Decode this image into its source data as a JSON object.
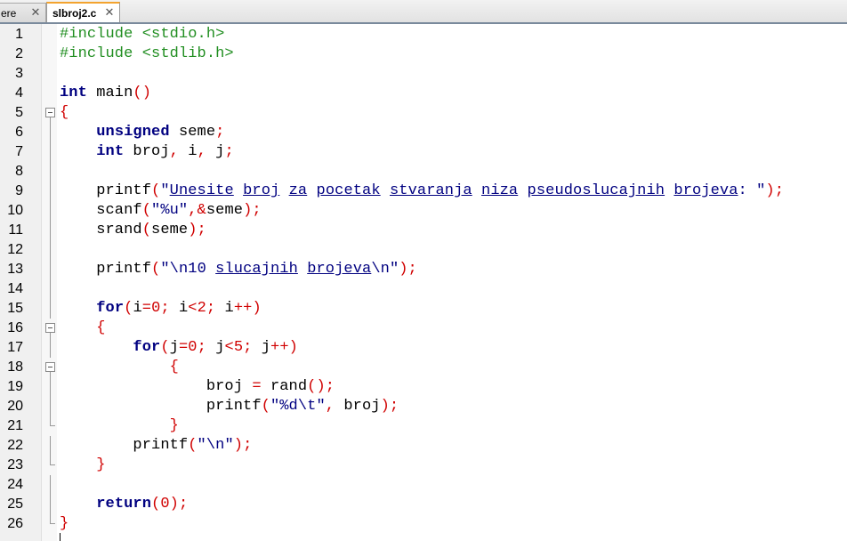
{
  "tabs": [
    {
      "label": "ere",
      "active": false
    },
    {
      "label": "slbroj2.c",
      "active": true
    }
  ],
  "colors": {
    "preprocessor": "#218e21",
    "keyword": "#000080",
    "operator": "#d00000",
    "string": "#000080",
    "tab_accent": "#f3a32e"
  },
  "code_lines": [
    {
      "n": "1",
      "fold": "",
      "tokens": [
        [
          "pre",
          "#include <stdio.h>"
        ]
      ]
    },
    {
      "n": "2",
      "fold": "",
      "tokens": [
        [
          "pre",
          "#include <stdlib.h>"
        ]
      ]
    },
    {
      "n": "3",
      "fold": "",
      "tokens": []
    },
    {
      "n": "4",
      "fold": "",
      "tokens": [
        [
          "kw",
          "int"
        ],
        [
          "plain",
          " main"
        ],
        [
          "op",
          "()"
        ]
      ]
    },
    {
      "n": "5",
      "fold": "open",
      "tokens": [
        [
          "op",
          "{"
        ]
      ]
    },
    {
      "n": "6",
      "fold": "line",
      "tokens": [
        [
          "plain",
          "    "
        ],
        [
          "kw",
          "unsigned"
        ],
        [
          "plain",
          " seme"
        ],
        [
          "op",
          ";"
        ]
      ]
    },
    {
      "n": "7",
      "fold": "line",
      "tokens": [
        [
          "plain",
          "    "
        ],
        [
          "kw",
          "int"
        ],
        [
          "plain",
          " broj"
        ],
        [
          "op",
          ","
        ],
        [
          "plain",
          " i"
        ],
        [
          "op",
          ","
        ],
        [
          "plain",
          " j"
        ],
        [
          "op",
          ";"
        ]
      ]
    },
    {
      "n": "8",
      "fold": "line",
      "tokens": []
    },
    {
      "n": "9",
      "fold": "line",
      "tokens": [
        [
          "plain",
          "    printf"
        ],
        [
          "op",
          "("
        ],
        [
          "str",
          "\"Unesite broj za pocetak stvaranja niza pseudoslucajnih brojeva: \""
        ],
        [
          "op",
          ");"
        ]
      ]
    },
    {
      "n": "10",
      "fold": "line",
      "tokens": [
        [
          "plain",
          "    scanf"
        ],
        [
          "op",
          "("
        ],
        [
          "str",
          "\"%u\""
        ],
        [
          "op",
          ",&"
        ],
        [
          "plain",
          "seme"
        ],
        [
          "op",
          ");"
        ]
      ]
    },
    {
      "n": "11",
      "fold": "line",
      "tokens": [
        [
          "plain",
          "    srand"
        ],
        [
          "op",
          "("
        ],
        [
          "plain",
          "seme"
        ],
        [
          "op",
          ");"
        ]
      ]
    },
    {
      "n": "12",
      "fold": "line",
      "tokens": []
    },
    {
      "n": "13",
      "fold": "line",
      "tokens": [
        [
          "plain",
          "    printf"
        ],
        [
          "op",
          "("
        ],
        [
          "str",
          "\"\\n10 slucajnih brojeva\\n\""
        ],
        [
          "op",
          ");"
        ]
      ]
    },
    {
      "n": "14",
      "fold": "line",
      "tokens": []
    },
    {
      "n": "15",
      "fold": "line",
      "tokens": [
        [
          "plain",
          "    "
        ],
        [
          "kw",
          "for"
        ],
        [
          "op",
          "("
        ],
        [
          "plain",
          "i"
        ],
        [
          "op",
          "="
        ],
        [
          "op",
          "0"
        ],
        [
          "op",
          ";"
        ],
        [
          "plain",
          " i"
        ],
        [
          "op",
          "<"
        ],
        [
          "op",
          "2"
        ],
        [
          "op",
          ";"
        ],
        [
          "plain",
          " i"
        ],
        [
          "op",
          "++)"
        ]
      ]
    },
    {
      "n": "16",
      "fold": "open",
      "tokens": [
        [
          "plain",
          "    "
        ],
        [
          "op",
          "{"
        ]
      ]
    },
    {
      "n": "17",
      "fold": "line",
      "tokens": [
        [
          "plain",
          "        "
        ],
        [
          "kw",
          "for"
        ],
        [
          "op",
          "("
        ],
        [
          "plain",
          "j"
        ],
        [
          "op",
          "="
        ],
        [
          "op",
          "0"
        ],
        [
          "op",
          ";"
        ],
        [
          "plain",
          " j"
        ],
        [
          "op",
          "<"
        ],
        [
          "op",
          "5"
        ],
        [
          "op",
          ";"
        ],
        [
          "plain",
          " j"
        ],
        [
          "op",
          "++)"
        ]
      ]
    },
    {
      "n": "18",
      "fold": "open",
      "tokens": [
        [
          "plain",
          "            "
        ],
        [
          "op",
          "{"
        ]
      ]
    },
    {
      "n": "19",
      "fold": "line",
      "tokens": [
        [
          "plain",
          "                broj "
        ],
        [
          "op",
          "="
        ],
        [
          "plain",
          " rand"
        ],
        [
          "op",
          "();"
        ]
      ]
    },
    {
      "n": "20",
      "fold": "line",
      "tokens": [
        [
          "plain",
          "                printf"
        ],
        [
          "op",
          "("
        ],
        [
          "str",
          "\"%d\\t\""
        ],
        [
          "op",
          ","
        ],
        [
          "plain",
          " broj"
        ],
        [
          "op",
          ");"
        ]
      ]
    },
    {
      "n": "21",
      "fold": "end",
      "tokens": [
        [
          "plain",
          "            "
        ],
        [
          "op",
          "}"
        ]
      ]
    },
    {
      "n": "22",
      "fold": "line",
      "tokens": [
        [
          "plain",
          "        printf"
        ],
        [
          "op",
          "("
        ],
        [
          "str",
          "\"\\n\""
        ],
        [
          "op",
          ");"
        ]
      ]
    },
    {
      "n": "23",
      "fold": "end",
      "tokens": [
        [
          "plain",
          "    "
        ],
        [
          "op",
          "}"
        ]
      ]
    },
    {
      "n": "24",
      "fold": "line",
      "tokens": []
    },
    {
      "n": "25",
      "fold": "line",
      "tokens": [
        [
          "plain",
          "    "
        ],
        [
          "kw",
          "return"
        ],
        [
          "op",
          "("
        ],
        [
          "op",
          "0"
        ],
        [
          "op",
          ");"
        ]
      ]
    },
    {
      "n": "26",
      "fold": "end",
      "tokens": [
        [
          "op",
          "}"
        ]
      ]
    }
  ]
}
